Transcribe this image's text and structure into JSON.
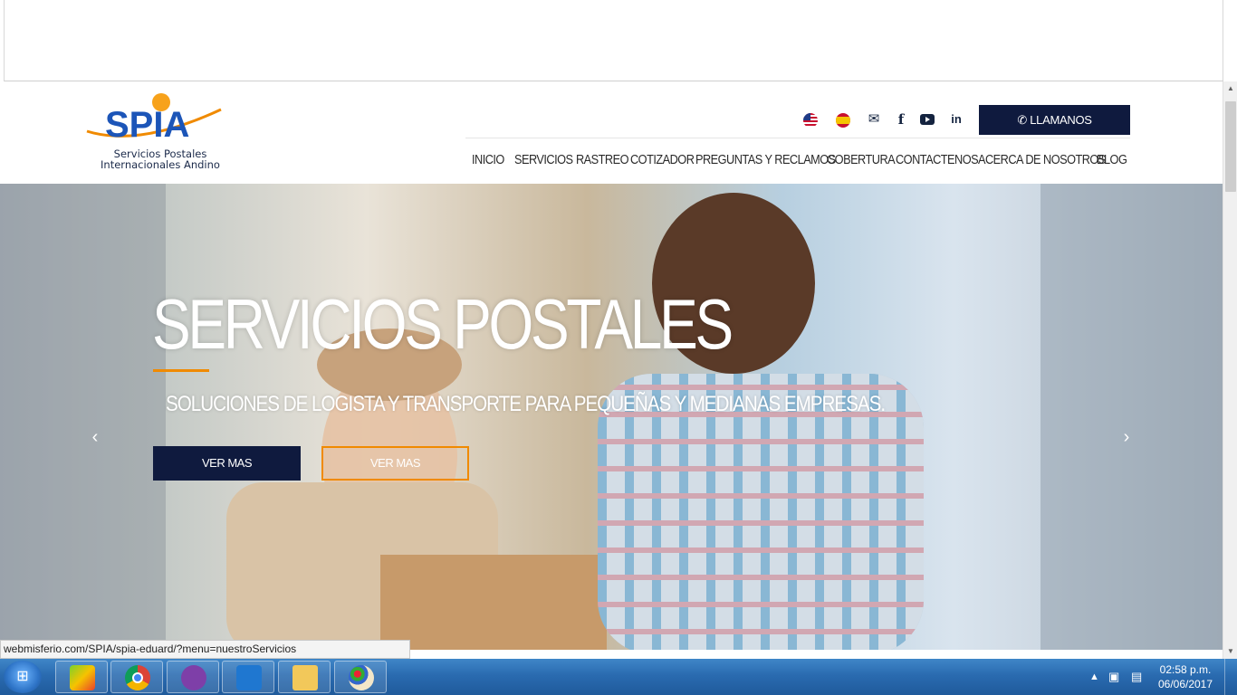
{
  "page": {
    "status_url": "webmisferio.com/SPIA/spia-eduard/?menu=nuestroServicios"
  },
  "logo": {
    "brand": "SPIA",
    "line1": "Servicios Postales",
    "line2": "Internacionales Andino"
  },
  "header": {
    "icons": [
      "flag-us-icon",
      "flag-es-icon",
      "envelope-icon",
      "facebook-icon",
      "youtube-icon",
      "linkedin-icon"
    ],
    "call_label": "✆ LLAMANOS",
    "nav": [
      "INICIO",
      "SERVICIOS",
      "RASTREO",
      "COTIZADOR",
      "PREGUNTAS Y RECLAMOS",
      "COBERTURA",
      "CONTACTENOS",
      "ACERCA DE NOSOTROS",
      "BLOG"
    ]
  },
  "hero": {
    "title": "SERVICIOS POSTALES",
    "subtitle": "SOLUCIONES DE LOGISTA Y TRANSPORTE PARA PEQUEÑAS Y MEDIANAS EMPRESAS.",
    "btn_primary": "VER MAS",
    "btn_secondary": "VER MAS"
  },
  "taskbar": {
    "time": "02:58 p.m.",
    "date": "06/06/2017"
  },
  "colors": {
    "navy": "#0f1a3e",
    "orange": "#f08a00",
    "progress_blue": "#2a8ef0"
  }
}
